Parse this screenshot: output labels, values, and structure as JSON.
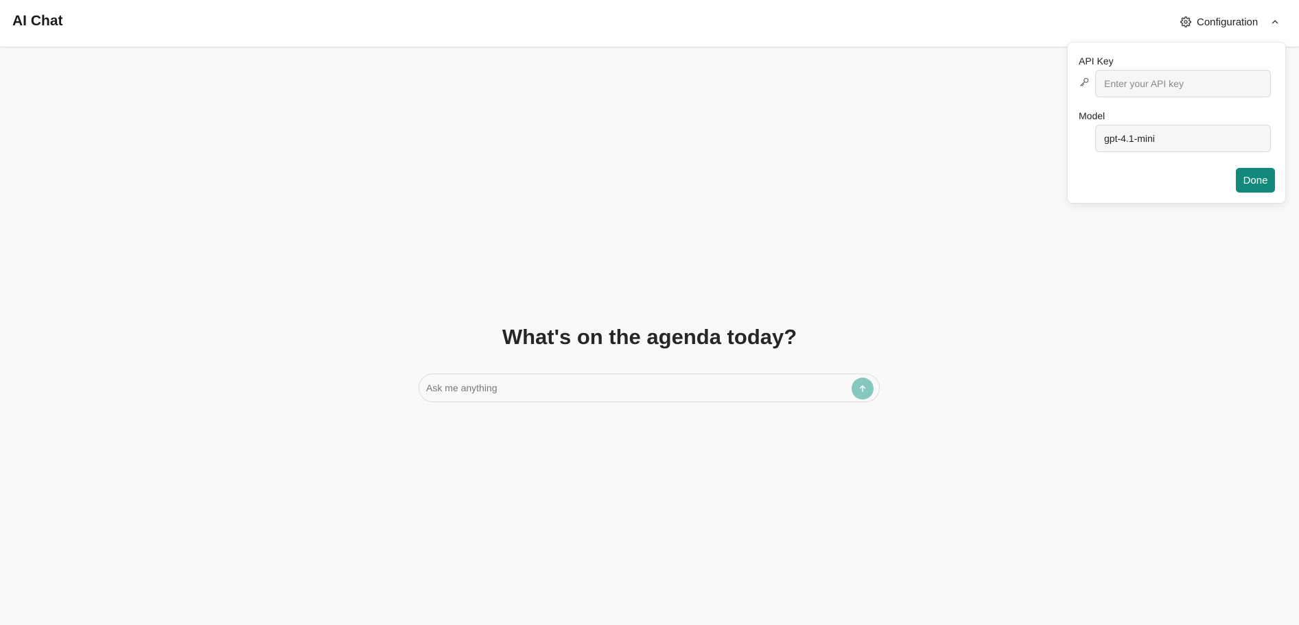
{
  "header": {
    "title": "AI Chat",
    "config_label": "Configuration"
  },
  "config_panel": {
    "api_key_label": "API Key",
    "api_key_placeholder": "Enter your API key",
    "api_key_value": "",
    "model_label": "Model",
    "model_value": "gpt-4.1-mini",
    "done_label": "Done"
  },
  "main": {
    "headline": "What's on the agenda today?",
    "chat_placeholder": "Ask me anything"
  },
  "icons": {
    "settings": "gear-icon",
    "chevron": "chevron-up-icon",
    "key": "key-icon",
    "send": "arrow-up-icon"
  },
  "colors": {
    "accent": "#13897b",
    "send_button": "#86c7bf",
    "background": "#f9f9f9"
  }
}
